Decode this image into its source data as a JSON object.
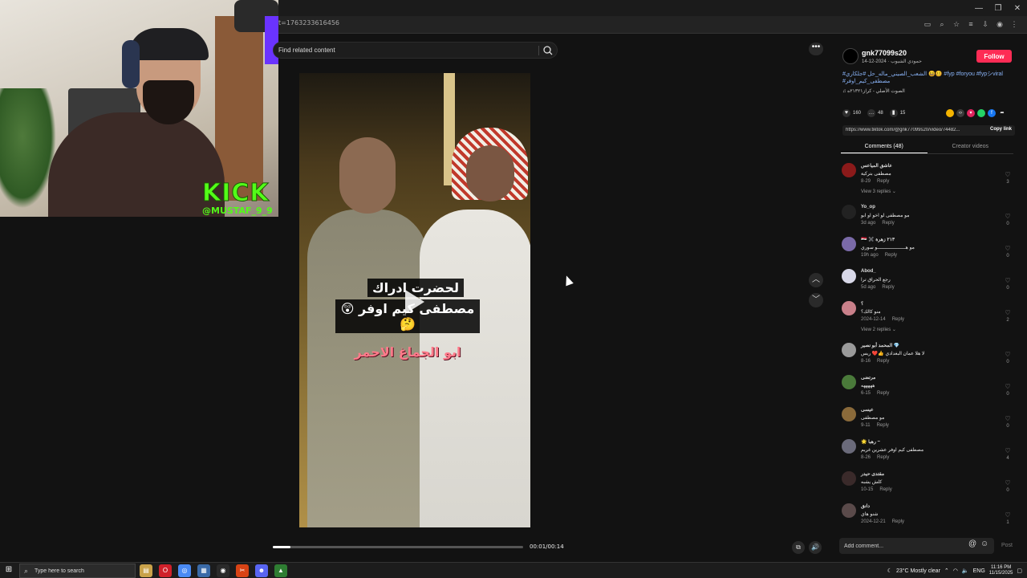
{
  "browser": {
    "url_fragment": "t=1763233616456"
  },
  "webcam": {
    "brand": "KICK",
    "handle": "@MUSTAF_9_9"
  },
  "search": {
    "placeholder": "Find related content"
  },
  "video": {
    "caption_line1": "لحضرت ادراك",
    "caption_line2": "مصطفى كيم اوفر 😲🤔",
    "caption_line3": "ابو الجماغ الاحمر",
    "time": "00:01/00:14",
    "progress": 0.07
  },
  "author": {
    "username": "gnk77099s20",
    "subtitle": "حمودي الشيوب · 2024-12-14",
    "follow_label": "Follow",
    "description": "#الشعب_الصيني_ماله_حل #جلكاري 😆🥴 #fyp #foryou #fypシviral #مصطفى_كيم_اوفر",
    "music": "♫ الصوت الأصلي - كراز٢١٣٢١ه"
  },
  "stats": {
    "likes": "160",
    "comments": "48",
    "saves": "15"
  },
  "link": {
    "url": "https://www.tiktok.com/@gnk77099s20/video/74482...",
    "copy_label": "Copy link"
  },
  "tabs": [
    {
      "label": "Comments (48)"
    },
    {
      "label": "Creator videos"
    }
  ],
  "comments": [
    {
      "user": "عاشق المياعس",
      "text": "مصطفى بتركية",
      "date": "8-29",
      "reply": "Reply",
      "likes": "3",
      "replies": "View 3 replies ⌄",
      "color": "#8b1a1a"
    },
    {
      "user": "Yo_op",
      "text": "مو مصطفى لو اخو او ابو",
      "date": "3d ago",
      "reply": "Reply",
      "likes": "0",
      "replies": "",
      "color": "#222222"
    },
    {
      "user": "🇮🇶 ✖️ ٢١٣ زهرة",
      "text": "مو هــــــــــــــــــــو سوري",
      "date": "19h ago",
      "reply": "Reply",
      "likes": "0",
      "replies": "",
      "color": "#7a6aa8"
    },
    {
      "user": "Abod_",
      "text": "رجع الحراق ترا",
      "date": "5d ago",
      "reply": "Reply",
      "likes": "0",
      "replies": "",
      "color": "#d8d8e8"
    },
    {
      "user": "؟",
      "text": "منو كالك؟",
      "date": "2024-12-14",
      "reply": "Reply",
      "likes": "2",
      "replies": "View 2 replies ⌄",
      "color": "#c9808a"
    },
    {
      "user": "المحمد أبو نصير 💎",
      "text": "لا هلا عمان البغدادي 👍❤️ ريس",
      "date": "8-16",
      "reply": "Reply",
      "likes": "0",
      "replies": "",
      "color": "#9a9a9a"
    },
    {
      "user": "مرتضى",
      "text": "هههههه",
      "date": "6-15",
      "reply": "Reply",
      "likes": "0",
      "replies": "",
      "color": "#4a7a3a"
    },
    {
      "user": "عيسى",
      "text": "مو مصطفى",
      "date": "9-11",
      "reply": "Reply",
      "likes": "0",
      "replies": "",
      "color": "#8a6a3a"
    },
    {
      "user": "🌟 رهبا ~",
      "text": "مصطفى كيم اوفر عشرين غريم",
      "date": "8-26",
      "reply": "Reply",
      "likes": "4",
      "replies": "",
      "color": "#6a6a7a"
    },
    {
      "user": "مقتدى حيدر",
      "text": "كلش يشبه",
      "date": "10-15",
      "reply": "Reply",
      "likes": "0",
      "replies": "",
      "color": "#3a2a2a"
    },
    {
      "user": "دانق",
      "text": "شنو هاي",
      "date": "2024-12-21",
      "reply": "Reply",
      "likes": "1",
      "replies": "",
      "color": "#5a4a4a"
    }
  ],
  "add_comment": {
    "placeholder": "Add comment...",
    "post_label": "Post"
  },
  "taskbar": {
    "search_placeholder": "Type here to search",
    "weather": "23°C  Mostly clear",
    "lang": "ENG",
    "time": "11:16 PM",
    "date": "11/15/2025"
  },
  "colors": {
    "accent": "#fe2c55",
    "kick_green": "#53fc18"
  }
}
